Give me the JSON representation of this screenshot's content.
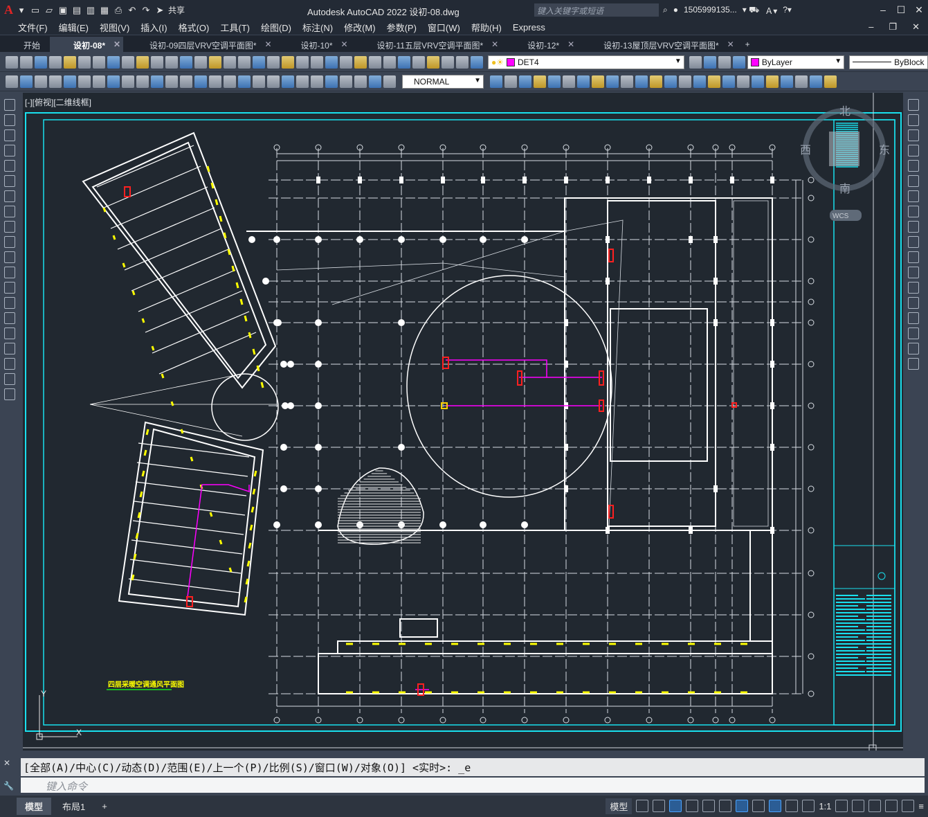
{
  "app": {
    "title": "Autodesk AutoCAD 2022    设初-08.dwg",
    "search_placeholder": "键入关键字或短语",
    "user": "1505999135...",
    "share": "共享"
  },
  "menu": [
    "文件(F)",
    "编辑(E)",
    "视图(V)",
    "插入(I)",
    "格式(O)",
    "工具(T)",
    "绘图(D)",
    "标注(N)",
    "修改(M)",
    "参数(P)",
    "窗口(W)",
    "帮助(H)",
    "Express"
  ],
  "tabs": [
    {
      "label": "开始",
      "active": false,
      "closable": false
    },
    {
      "label": "设初-08*",
      "active": true,
      "closable": true
    },
    {
      "label": "设初-09四层VRV空调平面图*",
      "active": false,
      "closable": true
    },
    {
      "label": "设初-10*",
      "active": false,
      "closable": true
    },
    {
      "label": "设初-11五层VRV空调平面图*",
      "active": false,
      "closable": true
    },
    {
      "label": "设初-12*",
      "active": false,
      "closable": true
    },
    {
      "label": "设初-13屋顶层VRV空调平面图*",
      "active": false,
      "closable": true
    }
  ],
  "toolbar": {
    "layer": "DET4",
    "color": "ByLayer",
    "linetype": "ByBlock",
    "dimstyle": "NORMAL",
    "layer_color": "#ff00ff"
  },
  "viewport": {
    "label": "[-][俯视][二维线框]",
    "compass": {
      "n": "北",
      "s": "南",
      "e": "东",
      "w": "西",
      "wcs": "WCS"
    },
    "drawing_title": "四层采暖空调通风平面图",
    "ucs": {
      "x": "X",
      "y": "Y"
    }
  },
  "command": {
    "history": "[全部(A)/中心(C)/动态(D)/范围(E)/上一个(P)/比例(S)/窗口(W)/对象(O)] <实时>: _e",
    "placeholder": "键入命令"
  },
  "layouts": [
    {
      "label": "模型",
      "active": true
    },
    {
      "label": "布局1",
      "active": false
    }
  ],
  "status": {
    "model": "模型",
    "scale": "1:1"
  },
  "colors": {
    "frame": "#19e0ee",
    "line": "#ffffff",
    "duct": "#ff00ff",
    "equip": "#ff2020",
    "label_yellow": "#ffff00"
  }
}
